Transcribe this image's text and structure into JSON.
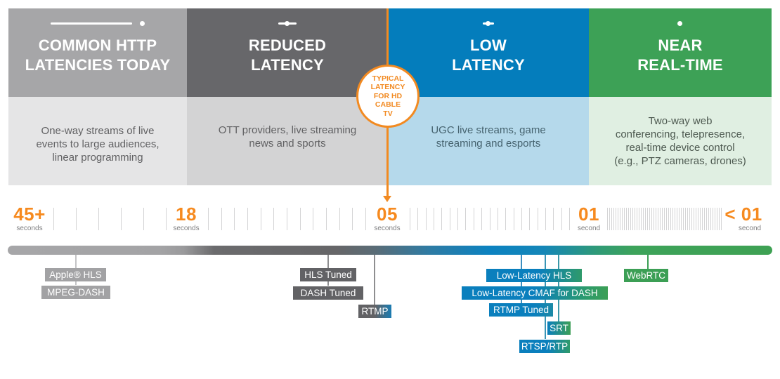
{
  "columns": [
    {
      "id": "common-http",
      "title": "COMMON HTTP\nLATENCIES TODAY",
      "description": "One-way streams of live\nevents to large audiences,\nlinear programming",
      "header_color": "#a6a6a8",
      "body_color": "#e5e5e6"
    },
    {
      "id": "reduced",
      "title": "REDUCED\nLATENCY",
      "description": "OTT providers, live streaming\nnews and sports",
      "header_color": "#67676a",
      "body_color": "#d3d3d4"
    },
    {
      "id": "low",
      "title": "LOW\nLATENCY",
      "description": "UGC live streams, game\nstreaming and esports",
      "header_color": "#047dbc",
      "body_color": "#b5d9eb"
    },
    {
      "id": "near-real-time",
      "title": "NEAR\nREAL-TIME",
      "description": "Two-way web\nconferencing, telepresence,\nreal-time device control\n(e.g., PTZ cameras, drones)",
      "header_color": "#3da156",
      "body_color": "#e0efe2"
    }
  ],
  "marker": {
    "label": "TYPICAL\nLATENCY\nFOR HD\nCABLE\nTV",
    "color": "#f28a21",
    "at_value": "05 seconds"
  },
  "scale": [
    {
      "value": "45+",
      "unit": "seconds"
    },
    {
      "value": "18",
      "unit": "seconds"
    },
    {
      "value": "05",
      "unit": "seconds"
    },
    {
      "value": "01",
      "unit": "second"
    },
    {
      "value": "< 01",
      "unit": "second"
    }
  ],
  "scale_color": "#f68a1f",
  "protocols": [
    {
      "name": "Apple® HLS",
      "category": "common-http"
    },
    {
      "name": "MPEG-DASH",
      "category": "common-http"
    },
    {
      "name": "HLS Tuned",
      "category": "reduced"
    },
    {
      "name": "DASH Tuned",
      "category": "reduced"
    },
    {
      "name": "RTMP",
      "category": "reduced"
    },
    {
      "name": "Low-Latency HLS",
      "category": "low"
    },
    {
      "name": "Low-Latency CMAF for DASH",
      "category": "low"
    },
    {
      "name": "RTMP Tuned",
      "category": "low"
    },
    {
      "name": "SRT",
      "category": "low"
    },
    {
      "name": "RTSP/RTP",
      "category": "low"
    },
    {
      "name": "WebRTC",
      "category": "near-real-time"
    }
  ]
}
